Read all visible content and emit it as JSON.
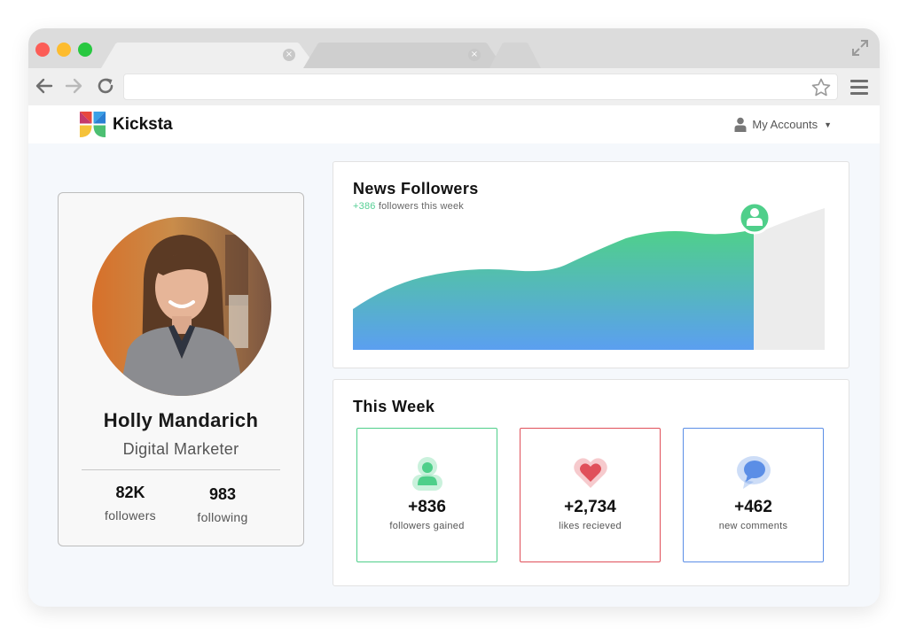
{
  "app": {
    "brand": "Kicksta",
    "accounts_label": "My Accounts"
  },
  "profile": {
    "name": "Holly Mandarich",
    "role": "Digital Marketer",
    "stats": [
      {
        "value": "82K",
        "label": "followers"
      },
      {
        "value": "983",
        "label": "following"
      }
    ]
  },
  "followers_panel": {
    "title": "News Followers",
    "delta": "+386",
    "delta_suffix": "followers this week"
  },
  "week_panel": {
    "title": "This Week",
    "metrics": [
      {
        "value": "+836",
        "label": "followers gained",
        "icon": "user-icon",
        "color": "#4fcf8a"
      },
      {
        "value": "+2,734",
        "label": "likes recieved",
        "icon": "heart-icon",
        "color": "#e0505a"
      },
      {
        "value": "+462",
        "label": "new comments",
        "icon": "speech-bubble-icon",
        "color": "#5b8ee6"
      }
    ]
  },
  "colors": {
    "chart_gradient_top": "#4fd08a",
    "chart_gradient_bottom": "#5b9ff0",
    "projection_fill": "#ececec",
    "traffic_red": "#fc5d57",
    "traffic_yellow": "#fdbc2e",
    "traffic_green": "#28c840"
  }
}
